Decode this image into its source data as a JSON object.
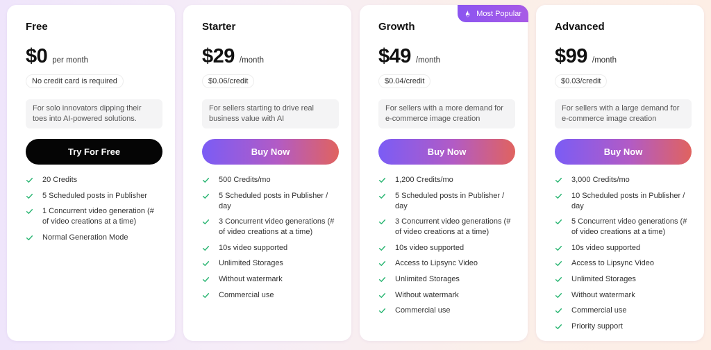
{
  "colors": {
    "accent_start": "#7b5cf5",
    "accent_end": "#e0635f",
    "check": "#2bb673",
    "dark_button": "#050505",
    "badge": "#8b55f0"
  },
  "plans": [
    {
      "name": "Free",
      "price": "$0",
      "period": "per month",
      "credit_tag": "No credit card is required",
      "description": "For solo innovators dipping their toes into AI-powered solutions.",
      "cta": "Try For Free",
      "cta_style": "dark",
      "features": [
        "20 Credits",
        "5 Scheduled posts in Publisher",
        "1 Concurrent video generation (# of video creations at a time)",
        "Normal Generation Mode"
      ]
    },
    {
      "name": "Starter",
      "price": "$29",
      "period": "/month",
      "credit_tag": "$0.06/credit",
      "description": "For sellers starting to drive real business value with AI",
      "cta": "Buy Now",
      "cta_style": "gradient",
      "features": [
        "500 Credits/mo",
        "5 Scheduled posts in Publisher / day",
        "3 Concurrent video generations (# of video creations at a time)",
        "10s video supported",
        "Unlimited Storages",
        "Without watermark",
        "Commercial use"
      ]
    },
    {
      "name": "Growth",
      "price": "$49",
      "period": "/month",
      "credit_tag": "$0.04/credit",
      "description": "For sellers with a more demand for e-commerce image creation",
      "cta": "Buy Now",
      "cta_style": "gradient",
      "badge": "Most Popular",
      "badge_icon": "flame-icon",
      "features": [
        "1,200 Credits/mo",
        "5 Scheduled posts in Publisher / day",
        "3 Concurrent video generations (# of video creations at a time)",
        "10s video supported",
        "Access to Lipsync Video",
        "Unlimited Storages",
        "Without watermark",
        "Commercial use"
      ]
    },
    {
      "name": "Advanced",
      "price": "$99",
      "period": "/month",
      "credit_tag": "$0.03/credit",
      "description": "For sellers with a large demand for e-commerce image creation",
      "cta": "Buy Now",
      "cta_style": "gradient",
      "features": [
        "3,000 Credits/mo",
        "10 Scheduled posts in Publisher / day",
        "5 Concurrent video generations (# of video creations at a time)",
        "10s video supported",
        "Access to Lipsync Video",
        "Unlimited Storages",
        "Without watermark",
        "Commercial use",
        "Priority support"
      ]
    }
  ]
}
